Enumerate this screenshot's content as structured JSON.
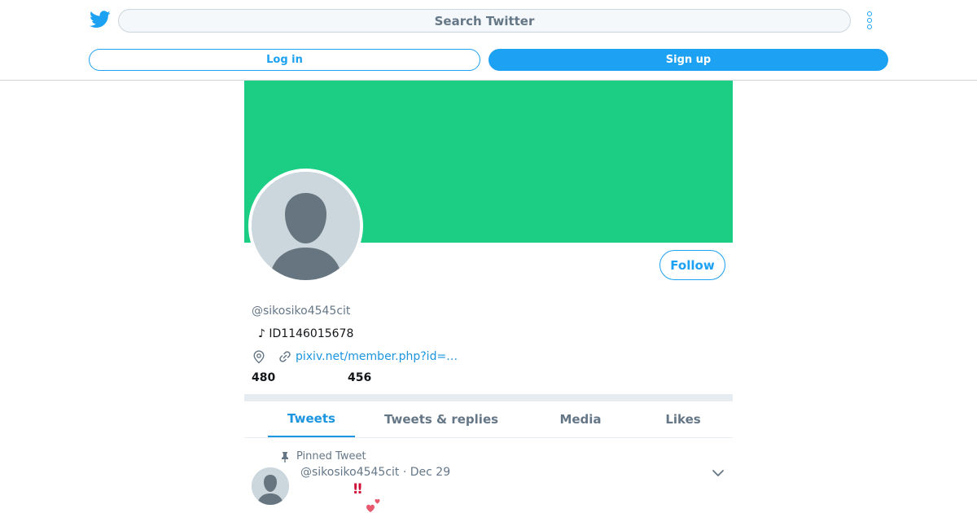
{
  "header": {
    "search_placeholder": "Search Twitter",
    "login_label": "Log in",
    "signup_label": "Sign up",
    "logo_icon": "twitter-bird-icon",
    "more_icon": "more-vertical-icon"
  },
  "profile": {
    "banner_color": "#1ccd84",
    "follow_label": "Follow",
    "handle": "@sikosiko4545cit",
    "bio": "♪ ID1146015678",
    "link_text": "pixiv.net/member.php?id=…",
    "following_count": "480",
    "followers_count": "456"
  },
  "tabs": [
    {
      "label": "Tweets",
      "active": true
    },
    {
      "label": "Tweets & replies",
      "active": false
    },
    {
      "label": "Media",
      "active": false
    },
    {
      "label": "Likes",
      "active": false
    }
  ],
  "tweet": {
    "pinned_label": "Pinned Tweet",
    "header": "@sikosiko4545cit · Dec 29",
    "emoji_bang": "‼",
    "emoji_hearts_icon": "two-hearts-icon"
  },
  "colors": {
    "accent": "#1da1f2",
    "link": "#1b95e0",
    "muted": "#657786"
  }
}
